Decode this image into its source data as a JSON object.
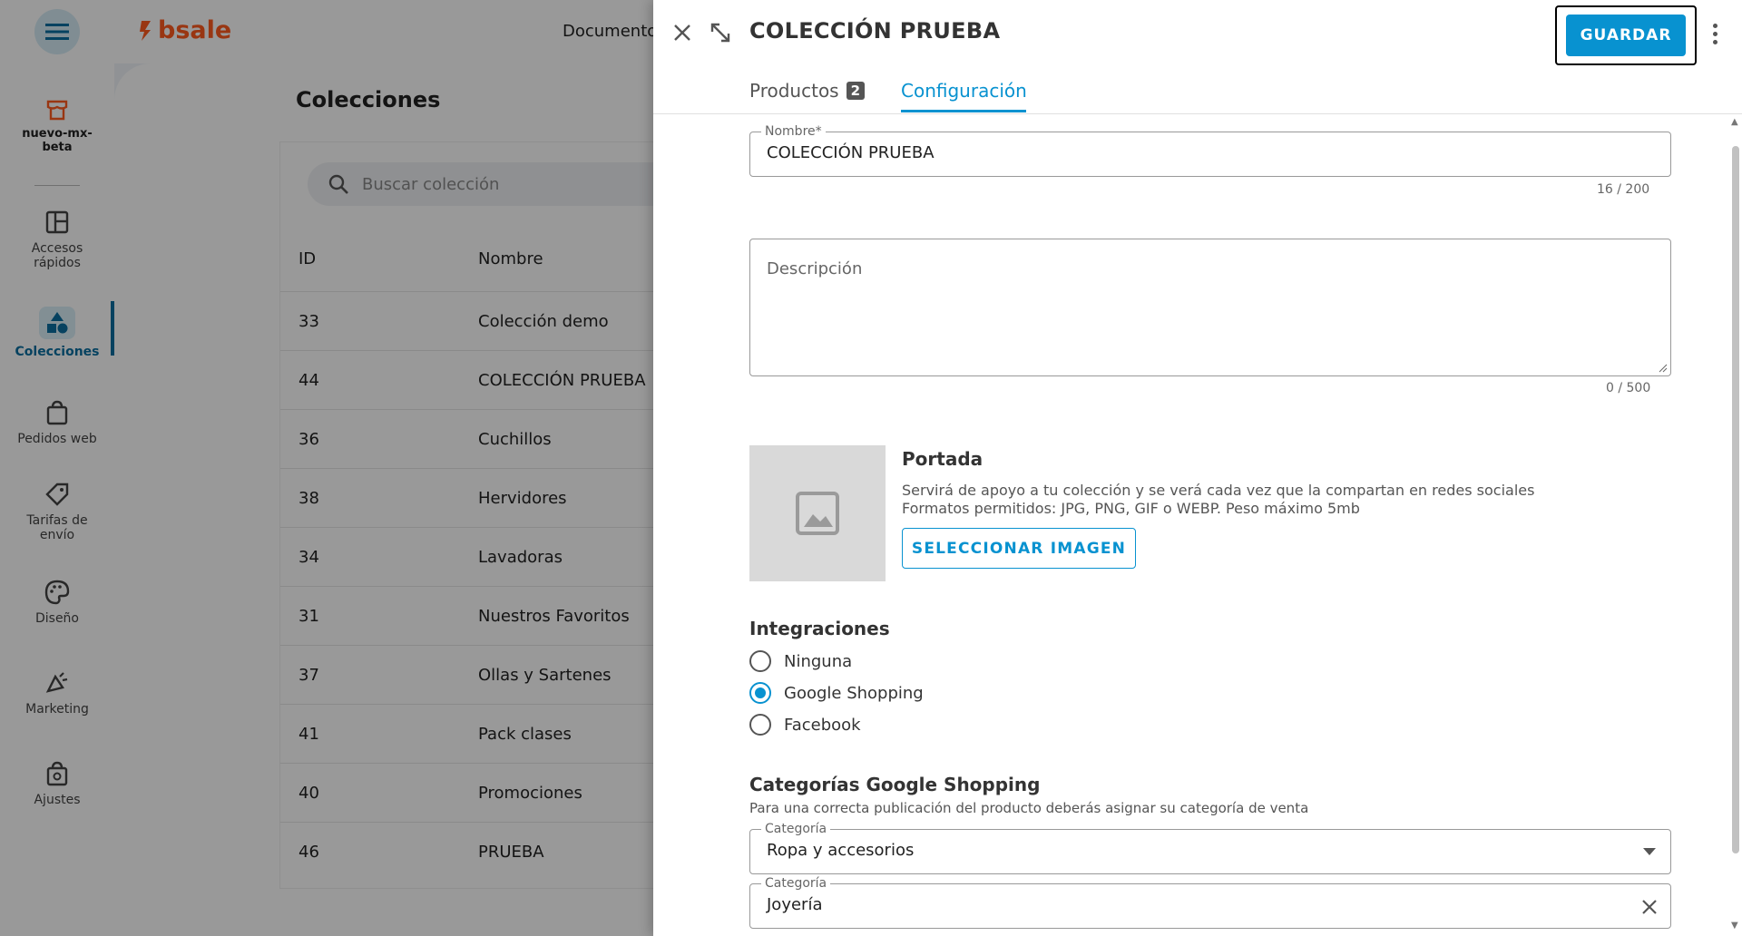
{
  "app": {
    "brand": "bsale",
    "top_nav": "Documentos",
    "store_name": "nuevo-mx-beta",
    "sidebar": [
      {
        "label": "Accesos rápidos"
      },
      {
        "label": "Colecciones"
      },
      {
        "label": "Pedidos web"
      },
      {
        "label": "Tarifas de envío"
      },
      {
        "label": "Diseño"
      },
      {
        "label": "Marketing"
      },
      {
        "label": "Ajustes"
      }
    ],
    "page_title": "Colecciones",
    "search_placeholder": "Buscar colección",
    "columns": [
      "ID",
      "Nombre"
    ],
    "rows": [
      {
        "id": "33",
        "name": "Colección demo"
      },
      {
        "id": "44",
        "name": "COLECCIÓN PRUEBA"
      },
      {
        "id": "36",
        "name": "Cuchillos"
      },
      {
        "id": "38",
        "name": "Hervidores"
      },
      {
        "id": "34",
        "name": "Lavadoras"
      },
      {
        "id": "31",
        "name": "Nuestros Favoritos"
      },
      {
        "id": "37",
        "name": "Ollas y Sartenes"
      },
      {
        "id": "41",
        "name": "Pack clases"
      },
      {
        "id": "40",
        "name": "Promociones"
      },
      {
        "id": "46",
        "name": "PRUEBA"
      }
    ]
  },
  "drawer": {
    "title": "COLECCIÓN PRUEBA",
    "save_label": "GUARDAR",
    "tabs": [
      {
        "label": "Productos",
        "badge": "2"
      },
      {
        "label": "Configuración"
      }
    ],
    "name_field": {
      "label": "Nombre*",
      "value": "COLECCIÓN PRUEBA",
      "counter": "16 / 200"
    },
    "description_field": {
      "placeholder": "Descripción",
      "counter": "0 / 500"
    },
    "cover": {
      "title": "Portada",
      "help1": "Servirá de apoyo a tu colección y se verá cada vez que la compartan en redes sociales",
      "help2": "Formatos permitidos: JPG, PNG, GIF o WEBP. Peso máximo 5mb",
      "button": "SELECCIONAR IMAGEN"
    },
    "integrations": {
      "title": "Integraciones",
      "options": [
        "Ninguna",
        "Google Shopping",
        "Facebook"
      ],
      "selected": "Google Shopping"
    },
    "google_categories": {
      "title": "Categorías Google Shopping",
      "help": "Para una correcta publicación del producto deberás asignar su categoría de venta",
      "field1": {
        "label": "Categoría",
        "value": "Ropa y accesorios"
      },
      "field2": {
        "label": "Categoría",
        "value": "Joyería"
      }
    }
  },
  "colors": {
    "primary": "#0892d0",
    "brand": "#ff5a1f"
  }
}
